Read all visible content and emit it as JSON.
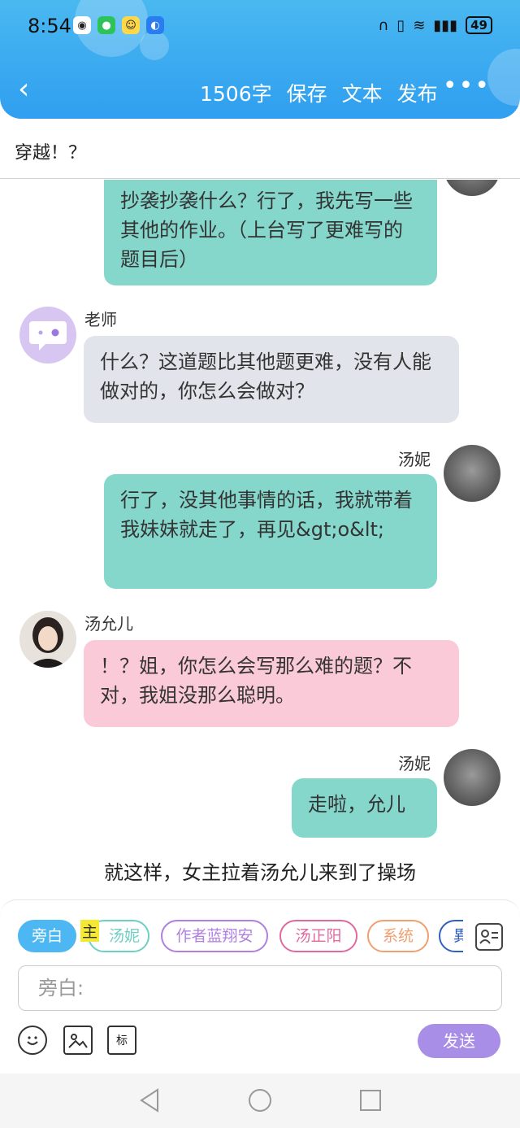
{
  "status_bar": {
    "time": "8:54",
    "battery": "49"
  },
  "header": {
    "word_count": "1506字",
    "save": "保存",
    "text": "文本",
    "publish": "发布",
    "more": "•••"
  },
  "doc_title": "穿越！？",
  "messages": [
    {
      "type": "right",
      "name": "",
      "text": "抄袭抄袭什么？行了，我先写一些其他的作业。（上台写了更难写的题目后）",
      "color": "green"
    },
    {
      "type": "left",
      "name": "老师",
      "text": "什么？这道题比其他题更难，没有人能做对的，你怎么会做对？",
      "color": "gray"
    },
    {
      "type": "right",
      "name": "汤妮",
      "text": "行了，没其他事情的话，我就带着我妹妹就走了，再见&gt;o&lt;",
      "color": "green"
    },
    {
      "type": "left",
      "name": "汤允儿",
      "text": "！？姐，你怎么会写那么难的题？不对，我姐没那么聪明。",
      "color": "pink"
    },
    {
      "type": "right",
      "name": "汤妮",
      "text": "走啦，允儿",
      "color": "green"
    },
    {
      "type": "narration",
      "text": "就这样，女主拉着汤允儿来到了操场"
    }
  ],
  "roles": [
    {
      "label": "旁白",
      "color": "#4cb7f2",
      "active": true
    },
    {
      "label": "主",
      "color": "#f5e832",
      "tag": true
    },
    {
      "label": "汤妮",
      "color": "#6fcfc3"
    },
    {
      "label": "作者蓝翔安",
      "color": "#b07fe0"
    },
    {
      "label": "汤正阳",
      "color": "#e06aa0"
    },
    {
      "label": "系统",
      "color": "#f0a070"
    },
    {
      "label": "異",
      "color": "#3060c0"
    }
  ],
  "input": {
    "placeholder": "旁白:"
  },
  "toolbar": {
    "mark": "标",
    "send": "发送"
  },
  "colors": {
    "accent": "#2f9ff0",
    "green_bubble": "#85d7cc",
    "gray_bubble": "#e1e4ea",
    "pink_bubble": "#fbcad8",
    "send": "#a98ee8"
  }
}
